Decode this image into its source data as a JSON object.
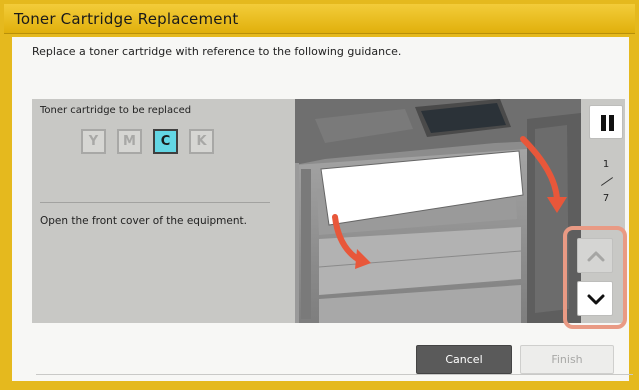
{
  "dialog": {
    "title": "Toner Cartridge Replacement",
    "instruction": "Replace a toner cartridge with reference to the following guidance."
  },
  "toner": {
    "label": "Toner cartridge to be replaced",
    "chips": [
      {
        "letter": "Y",
        "active": false
      },
      {
        "letter": "M",
        "active": false
      },
      {
        "letter": "C",
        "active": true
      },
      {
        "letter": "K",
        "active": false
      }
    ]
  },
  "step": {
    "text": "Open the front cover of the equipment.",
    "current": "1",
    "total": "7"
  },
  "icons": {
    "pause": "pause-icon",
    "up": "chevron-up-icon",
    "down": "chevron-down-icon"
  },
  "buttons": {
    "cancel": "Cancel",
    "finish": "Finish"
  },
  "colors": {
    "frame": "#e5b91e",
    "active_chip": "#63d6e4",
    "arrow": "#e8573a",
    "highlight": "#e99a84"
  }
}
